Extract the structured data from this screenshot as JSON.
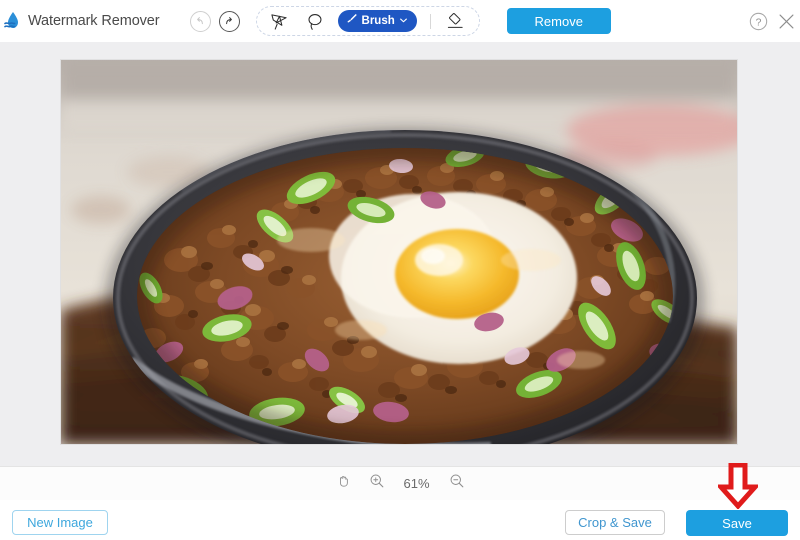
{
  "app": {
    "title": "Watermark Remover",
    "logo_icon": "water-drop-wave-icon"
  },
  "header": {
    "undo_icon": "undo-arrow-icon",
    "redo_icon": "redo-arrow-icon",
    "tools": [
      {
        "name": "polygon-lasso-tool",
        "icon": "polygon-lasso-icon"
      },
      {
        "name": "free-lasso-tool",
        "icon": "lasso-loop-icon"
      }
    ],
    "brush": {
      "label": "Brush",
      "icon": "paintbrush-icon",
      "chevron_icon": "chevron-down-icon",
      "color": "#1f57c3"
    },
    "eraser_icon": "eraser-icon",
    "remove_label": "Remove",
    "remove_color": "#1d9fe0",
    "help_icon": "question-mark-circle-icon",
    "close_icon": "close-x-icon"
  },
  "canvas": {
    "image_alt": "sizzling ground meat dish with fried egg, green chili slices and red onion on a dark oval plate",
    "background_color": "#eeeef0"
  },
  "zoombar": {
    "hand_icon": "hand-pan-icon",
    "zoom_in_icon": "magnifier-plus-icon",
    "zoom_level": "61%",
    "zoom_out_icon": "magnifier-minus-icon"
  },
  "footer": {
    "new_image_label": "New Image",
    "crop_save_label": "Crop & Save",
    "save_label": "Save",
    "save_color": "#1d9fe0",
    "new_image_border_color": "#9fd4ef"
  },
  "annotation": {
    "arrow_icon": "down-arrow-annotation-icon",
    "arrow_color": "#e01b1b"
  }
}
